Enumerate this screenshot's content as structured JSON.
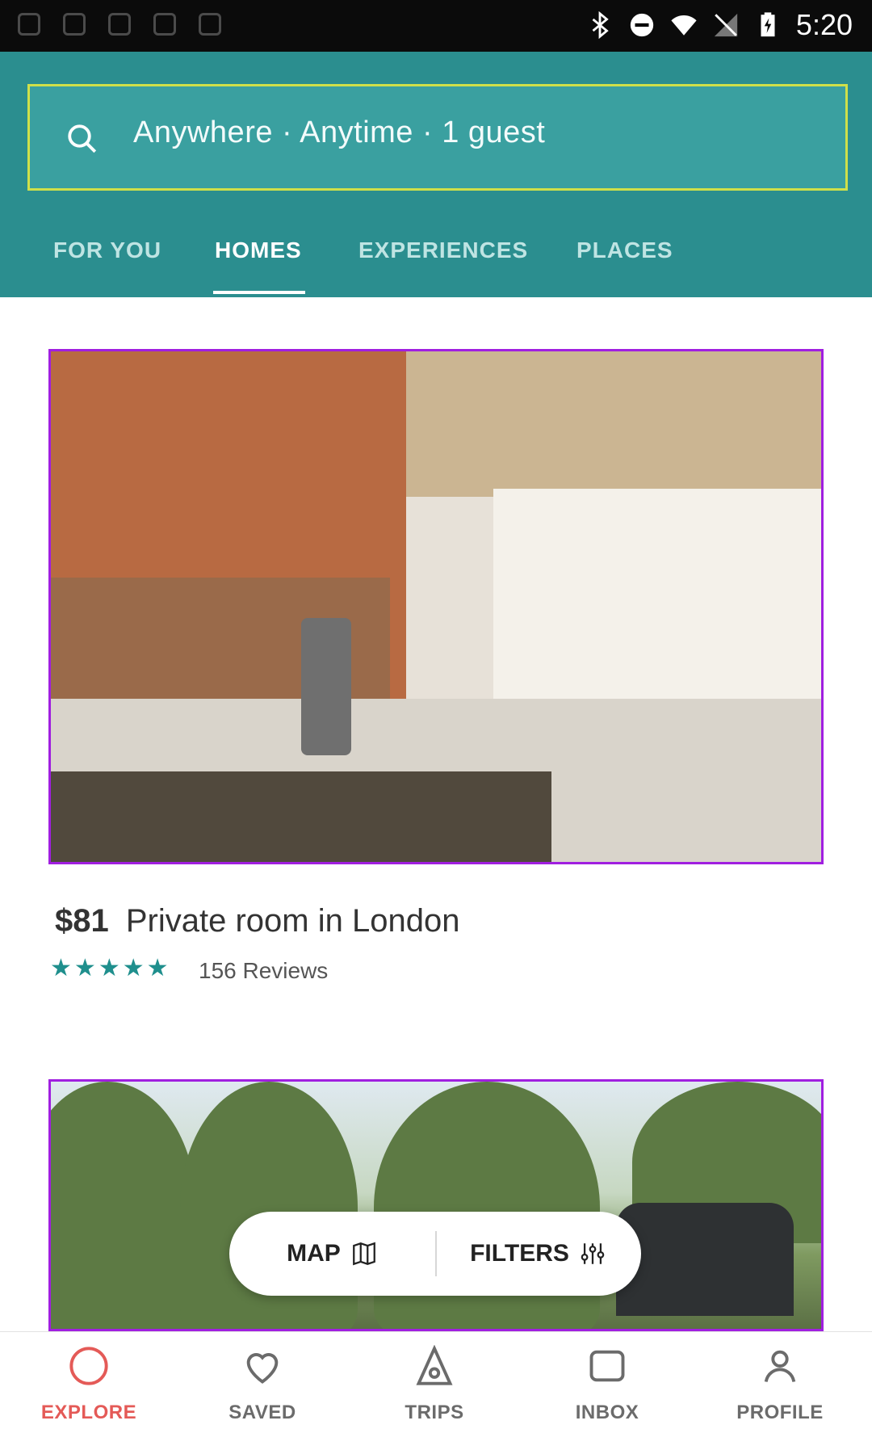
{
  "status_bar": {
    "time": "5:20"
  },
  "header": {
    "search_text": "Anywhere · Anytime · 1 guest",
    "tabs": [
      {
        "label": "FOR YOU"
      },
      {
        "label": "HOMES"
      },
      {
        "label": "EXPERIENCES"
      },
      {
        "label": "PLACES"
      }
    ],
    "active_tab": "HOMES"
  },
  "listing": {
    "price": "$81",
    "title": "Private room in London",
    "reviews": "156 Reviews",
    "rating_stars": 5
  },
  "actions": {
    "map_label": "MAP",
    "filters_label": "FILTERS"
  },
  "bottom_nav": [
    {
      "label": "EXPLORE",
      "icon": "explore-icon"
    },
    {
      "label": "SAVED",
      "icon": "heart-icon"
    },
    {
      "label": "TRIPS",
      "icon": "trips-icon"
    },
    {
      "label": "INBOX",
      "icon": "inbox-icon"
    },
    {
      "label": "PROFILE",
      "icon": "profile-icon"
    }
  ],
  "colors": {
    "header_bg": "#2b8e8f",
    "accent": "#1f8f8d",
    "active_nav": "#e45a57"
  }
}
